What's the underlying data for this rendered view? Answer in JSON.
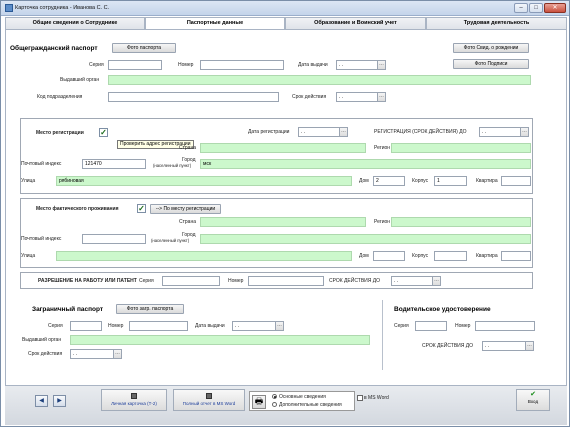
{
  "window": {
    "title": "Карточка сотрудника - Иванова С. С.",
    "min": "–",
    "max": "□",
    "close": "✕"
  },
  "tabs": [
    "Общие сведения о Сотруднике",
    "Паспортные данные",
    "Образование и Воинский учет",
    "Трудовая деятельность"
  ],
  "passport": {
    "heading": "Общегражданский паспорт",
    "photo_btn": "Фото паспорта",
    "birth_cert_btn": "Фото Свид. о рождении",
    "signature_btn": "Фото Подписи",
    "series_label": "Серия",
    "number_label": "Номер",
    "issue_date_label": "Дата выдачи",
    "issue_date_val": ". .",
    "issuer_label": "Выдавший орган",
    "division_label": "Код подразделения",
    "validity_label": "Срок действия",
    "validity_val": ". ."
  },
  "registration": {
    "place_label": "Место регистрации",
    "reg_date_label": "Дата регистрации",
    "reg_date_val": ". .",
    "reg_until_label": "РЕГИСТРАЦИЯ (СРОК ДЕЙСТВИЯ) ДО",
    "reg_until_val": ". .",
    "tooltip": "Проверить адрес регистрации",
    "country_label": "Страна",
    "region_label": "Регион",
    "postal_label": "Почтовый индекс",
    "postal_val": "121470",
    "city_label": "Город",
    "city_sub": "(населенный пункт)",
    "city_val": "мск",
    "street_label": "Улица",
    "street_val": "рябиновая",
    "house_label": "Дом",
    "house_val": "2",
    "building_label": "Корпус",
    "building_val": "1",
    "apartment_label": "Квартира"
  },
  "actual": {
    "place_label": "Место фактического проживания",
    "same_btn": "--> По месту регистрации",
    "country_label": "Страна",
    "region_label": "Регион",
    "postal_label": "Почтовый индекс",
    "city_label": "Город",
    "city_sub": "(населенный пункт)",
    "street_label": "Улица",
    "house_label": "Дом",
    "building_label": "Корпус",
    "apartment_label": "Квартира"
  },
  "permit": {
    "label": "РАЗРЕШЕНИЕ НА РАБОТУ ИЛИ ПАТЕНТ",
    "series_label": "Серия",
    "number_label": "Номер",
    "until_label": "СРОК ДЕЙСТВИЯ ДО",
    "until_val": ". ."
  },
  "foreign": {
    "heading": "Заграничный паспорт",
    "photo_btn": "Фото загр. паспорта",
    "series_label": "Серия",
    "number_label": "Номер",
    "issue_date_label": "Дата выдачи",
    "issue_date_val": ". .",
    "issuer_label": "Выдавший орган",
    "validity_label": "Срок действия",
    "validity_val": ". ."
  },
  "license": {
    "heading": "Водительское удостоверение",
    "series_label": "Серия",
    "number_label": "Номер",
    "until_label": "СРОК ДЕЙСТВИЯ ДО",
    "until_val": ". ."
  },
  "bottom": {
    "prev": "◀",
    "next": "▶",
    "card_btn": "Личная карточка (Т-2)",
    "report_btn": "Полный отчет в MS Word",
    "radio_main": "Основные сведения",
    "radio_extra": "Дополнительные сведения",
    "ms_word_label": "в MS Word",
    "enter_btn": "Вход"
  }
}
